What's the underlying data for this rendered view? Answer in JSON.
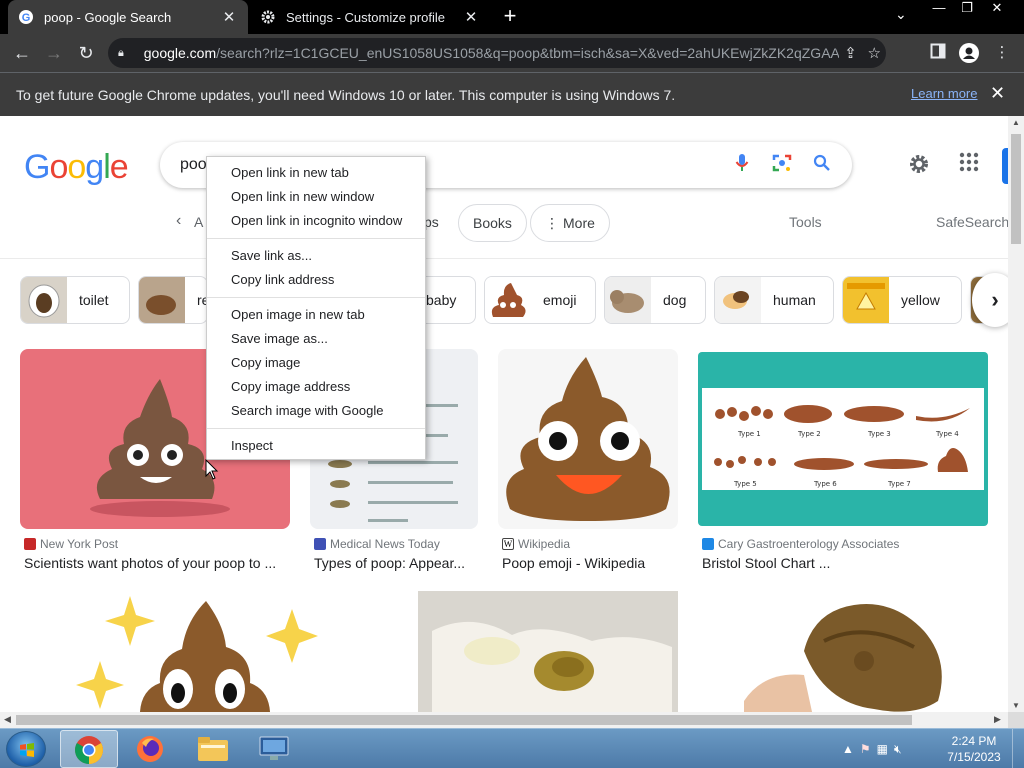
{
  "browser": {
    "tabs": [
      {
        "title": "poop - Google Search",
        "active": true,
        "icon": "google-favicon"
      },
      {
        "title": "Settings - Customize profile",
        "active": false,
        "icon": "gear-icon"
      }
    ],
    "url_host": "google.com",
    "url_rest": "/search?rlz=1C1GCEU_enUS1058US1058&q=poop&tbm=isch&sa=X&ved=2ahUKEwjZkZK2qZGAAx...",
    "infobar_message": "To get future Google Chrome updates, you'll need Windows 10 or later. This computer is using Windows 7.",
    "infobar_link": "Learn more"
  },
  "search": {
    "query": "poo",
    "logo": "Google",
    "filters": {
      "all_partial": "A",
      "ps_partial": "ps",
      "books": "Books",
      "more": "More",
      "tools": "Tools",
      "safesearch": "SafeSearch"
    },
    "chips": [
      {
        "label": "toilet"
      },
      {
        "label": "re"
      },
      {
        "label": "baby"
      },
      {
        "label": "emoji"
      },
      {
        "label": "dog"
      },
      {
        "label": "human"
      },
      {
        "label": "yellow"
      }
    ],
    "results": [
      {
        "source": "New York Post",
        "caption": "Scientists want photos of your poop to ..."
      },
      {
        "source": "Medical News Today",
        "caption": "Types of poop: Appear..."
      },
      {
        "source": "Wikipedia",
        "caption": "Poop emoji - Wikipedia"
      },
      {
        "source": "Cary Gastroenterology Associates",
        "caption": "Bristol Stool Chart ..."
      }
    ],
    "bristol_labels": [
      "Type 1",
      "Type 2",
      "Type 3",
      "Type 4",
      "Type 5",
      "Type 6",
      "Type 7"
    ]
  },
  "context_menu": {
    "group1": [
      "Open link in new tab",
      "Open link in new window",
      "Open link in incognito window"
    ],
    "group2": [
      "Save link as...",
      "Copy link address"
    ],
    "group3": [
      "Open image in new tab",
      "Save image as...",
      "Copy image",
      "Copy image address",
      "Search image with Google"
    ],
    "group4": [
      "Inspect"
    ]
  },
  "taskbar": {
    "time": "2:24 PM",
    "date": "7/15/2023"
  },
  "colors": {
    "accent": "#1a73e8",
    "poop_brown": "#8b5a2b",
    "pink_bg": "#e8707a",
    "teal_bg": "#2ab4a8"
  }
}
